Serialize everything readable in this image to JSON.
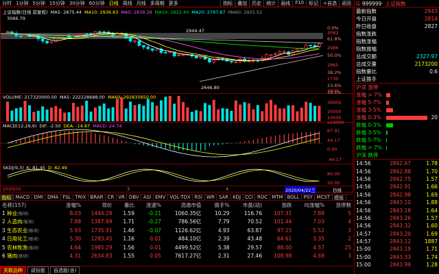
{
  "toolbar": {
    "periods": [
      "分时",
      "1分钟",
      "5分钟",
      "15分钟",
      "30分钟",
      "60分钟",
      "日线",
      "周线",
      "月线",
      "多周期",
      "更多"
    ],
    "active_period": "日线",
    "right_items": [
      "指标",
      "叠加",
      "历史",
      "统计",
      "画线",
      "F10",
      "标记",
      "+自选",
      "返回"
    ]
  },
  "main_chart": {
    "legend": [
      "上证指数(日线 前复权)",
      "MA5: 2875.44",
      "MA10: 2936.63",
      "MA5: 2839.39",
      "MA10: 2822.40",
      "MA20: 2797.87",
      "MA60: 2925.52"
    ],
    "high_label": "3066.79",
    "annotation": "2944.47",
    "low_label": "2646.80",
    "y_labels": [
      "3082",
      "2986",
      "2865",
      "2730",
      "2609"
    ],
    "pct_labels": [
      "0.0%",
      "61.8%",
      "50.0%",
      "38.2%",
      "23.6%",
      "19.1%"
    ]
  },
  "volume_panel": {
    "legend": [
      "VOLUME: 217320000.00",
      "MA5: 222228688.00",
      "MA60: 292835650.00"
    ],
    "y_labels": [
      "30000",
      "20000",
      "10000",
      "x10000"
    ]
  },
  "macd_panel": {
    "legend": [
      "MACD(12,26,9)",
      "DIF: -2.50",
      "DEA: -14.87",
      "MACD: 24.74"
    ],
    "y_labels": [
      "67.91",
      "44.17",
      "0.00",
      "-44.17"
    ]
  },
  "skdj_panel": {
    "legend": [
      "SKDJ(9,3)",
      "K: 81.45",
      "D: 82.49"
    ],
    "y_labels": [
      "80.00",
      "20.00"
    ]
  },
  "x_axis": {
    "left": "2020/02",
    "mid1": "3",
    "mid2": "4",
    "cursor": "2020/04/22三",
    "right": "日线"
  },
  "tabs": [
    "指标",
    "MACD",
    "DMI",
    "DMA",
    "FSL",
    "TRIX",
    "BRAR",
    "CR",
    "VR",
    "OBV",
    "ASI",
    "EMV",
    "VOL-TDX",
    "RSI",
    "WR",
    "SAR",
    "KDJ",
    "CCI",
    "ROC",
    "MTM",
    "BOLL",
    "PSY",
    "MCST",
    "模板"
  ],
  "active_tab": "指标",
  "sector_table": {
    "headers": [
      "名称(157)",
      "涨幅%",
      "现价",
      "量比",
      "涨速%",
      "流通市值",
      "换手%",
      "市盈(动)",
      "涨跌",
      "均涨幅%",
      "涨停数"
    ],
    "rows": [
      {
        "idx": "1",
        "name": "种业",
        "tag": "(板块)",
        "chg": "8.03",
        "price": "1444.29",
        "vol_ratio": "1.59",
        "speed": "-0.21",
        "cap": "1060.35亿",
        "turnover": "10.29",
        "pe": "116.76",
        "diff": "107.31",
        "avg": "7.88",
        "limit": "5"
      },
      {
        "idx": "2",
        "name": "人造肉",
        "tag": "(板块)",
        "chg": "7.88",
        "price": "1387.99",
        "vol_ratio": "1.71",
        "speed": "-0.27",
        "cap": "786.56亿",
        "turnover": "7.79",
        "pe": "70.52",
        "diff": "101.44",
        "avg": "7.03",
        "limit": "4"
      },
      {
        "idx": "3",
        "name": "生态农业",
        "tag": "(板块)",
        "chg": "5.93",
        "price": "1735.91",
        "vol_ratio": "1.46",
        "speed": "-0.07",
        "cap": "1126.62亿",
        "turnover": "4.93",
        "pe": "63.87",
        "diff": "97.15",
        "avg": "5.52",
        "limit": "3"
      },
      {
        "idx": "4",
        "name": "日用化工",
        "tag": "(板块)",
        "chg": "5.30",
        "price": "1283.45",
        "vol_ratio": "1.16",
        "speed": "0.01",
        "cap": "484.10亿",
        "turnover": "2.39",
        "pe": "43.48",
        "diff": "64.61",
        "avg": "3.35",
        "limit": "2"
      },
      {
        "idx": "5",
        "name": "农林牧渔",
        "tag": "(板块)",
        "chg": "4.64",
        "price": "1985.29",
        "vol_ratio": "1.56",
        "speed": "0.01",
        "cap": "4499.52亿",
        "turnover": "5.38",
        "pe": "29.57",
        "diff": "88.00",
        "avg": "4.57",
        "limit": "25"
      },
      {
        "idx": "6",
        "name": "猪肉",
        "tag": "(板块)",
        "chg": "4.31",
        "price": "2634.83",
        "vol_ratio": "1.55",
        "speed": "0.05",
        "cap": "7617.27亿",
        "turnover": "2.31",
        "pe": "27.46",
        "diff": "108.98",
        "avg": "4.69",
        "limit": "3"
      }
    ]
  },
  "bottom_tabs": [
    "关联品种",
    "成份股",
    "自选股(含)"
  ],
  "right_panel": {
    "code": "999999",
    "name": "上证指数",
    "quote": [
      {
        "k": "最新指数",
        "v": "2843",
        "c": "red"
      },
      {
        "k": "今日开盘",
        "v": "2814",
        "c": "red"
      },
      {
        "k": "昨日收盘",
        "v": "2827",
        "c": "white"
      },
      {
        "k": "指数涨跌",
        "v": "",
        "c": "red"
      },
      {
        "k": "指数涨幅",
        "v": "",
        "c": "red"
      },
      {
        "k": "指数振幅",
        "v": "",
        "c": "white"
      },
      {
        "k": "总成交额",
        "v": "2327.97",
        "c": "cyan"
      },
      {
        "k": "总成交量",
        "v": "2173200",
        "c": "yellow"
      },
      {
        "k": "指数量比",
        "v": "0.6",
        "c": "white"
      },
      {
        "k": "上证换手",
        "v": "",
        "c": "white"
      }
    ],
    "breadth_title": "沪深 涨停",
    "breadth_up": [
      {
        "k": "涨幅 > 7%",
        "v": "",
        "w": 6
      },
      {
        "k": "涨幅 5-7%",
        "v": "",
        "w": 4
      },
      {
        "k": "涨幅 3-5%",
        "v": "",
        "w": 10
      },
      {
        "k": "涨幅 0-3%",
        "v": "20",
        "w": 60
      }
    ],
    "breadth_down": [
      {
        "k": "跌幅 0-3%",
        "v": "",
        "w": 10
      },
      {
        "k": "跌幅 3-5%",
        "v": "",
        "w": 2
      },
      {
        "k": "跌幅 5-7%",
        "v": "",
        "w": 1
      },
      {
        "k": "跌幅 > 7%",
        "v": "",
        "w": 1
      }
    ],
    "breadth_footer": "沪深 跌停",
    "ticks": [
      {
        "t": "14:56",
        "p": "2842.67",
        "q": "1.78"
      },
      {
        "t": "14:56",
        "p": "2842.88",
        "q": "1.70"
      },
      {
        "t": "14:56",
        "p": "2842.75",
        "q": "1.57"
      },
      {
        "t": "14:56",
        "p": "2842.91",
        "q": "1.66"
      },
      {
        "t": "14:56",
        "p": "2842.98",
        "q": "1.69"
      },
      {
        "t": "14:56",
        "p": "2843.10",
        "q": "1.88"
      },
      {
        "t": "14:56",
        "p": "2843.18",
        "q": "1.64"
      },
      {
        "t": "14:56",
        "p": "2843.26",
        "q": "1.57"
      },
      {
        "t": "14:56",
        "p": "2843.32",
        "q": "1.60"
      },
      {
        "t": "14:57",
        "p": "2843.20",
        "q": "1.69"
      },
      {
        "t": "14:57",
        "p": "2843.12",
        "q": "1887"
      },
      {
        "t": "15:00",
        "p": "2843.19",
        "q": "1.71"
      },
      {
        "t": "15:00",
        "p": "2843.33",
        "q": "1.74"
      },
      {
        "t": "15:00",
        "p": "2843.99",
        "q": "1.28"
      }
    ]
  }
}
